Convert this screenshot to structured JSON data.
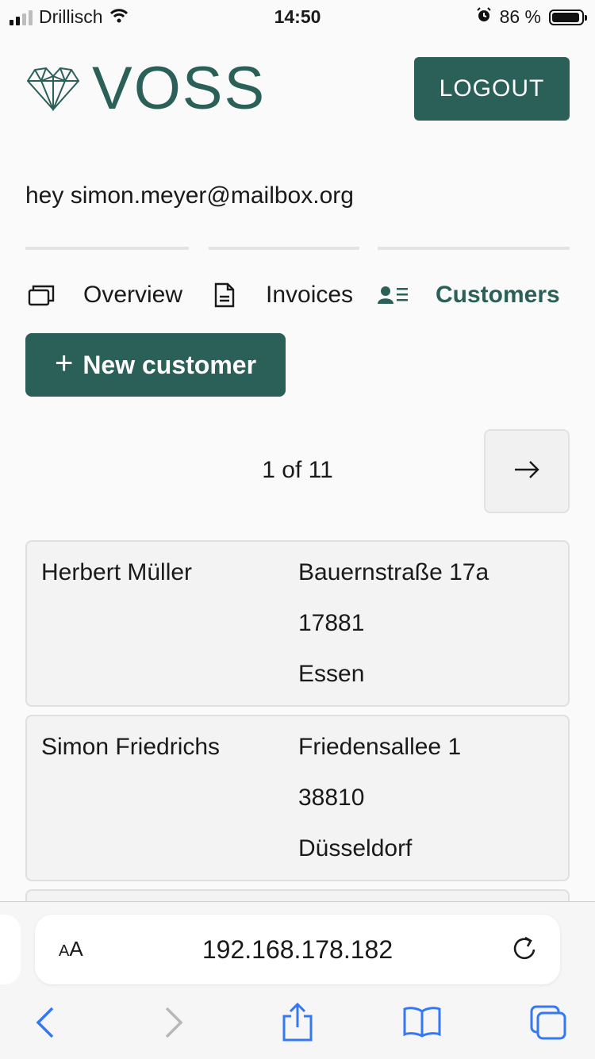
{
  "status_bar": {
    "carrier": "Drillisch",
    "time": "14:50",
    "battery": "86 %"
  },
  "header": {
    "brand": "VOSS",
    "logout_label": "LOGOUT"
  },
  "greeting": "hey simon.meyer@mailbox.org",
  "tabs": [
    {
      "label": "Overview",
      "icon": "overview-icon",
      "active": false
    },
    {
      "label": "Invoices",
      "icon": "document-icon",
      "active": false
    },
    {
      "label": "Customers",
      "icon": "contacts-icon",
      "active": true
    }
  ],
  "new_customer_label": "New customer",
  "pagination": {
    "text": "1 of 11"
  },
  "customers": [
    {
      "name": "Herbert Müller",
      "street": "Bauernstraße 17a",
      "zip": "17881",
      "city": "Essen"
    },
    {
      "name": "Simon Friedrichs",
      "street": "Friedensallee 1",
      "zip": "38810",
      "city": "Düsseldorf"
    }
  ],
  "browser": {
    "aa_label": "AA",
    "url": "192.168.178.182"
  },
  "colors": {
    "accent": "#2a6058",
    "ios_blue": "#3478f6"
  }
}
